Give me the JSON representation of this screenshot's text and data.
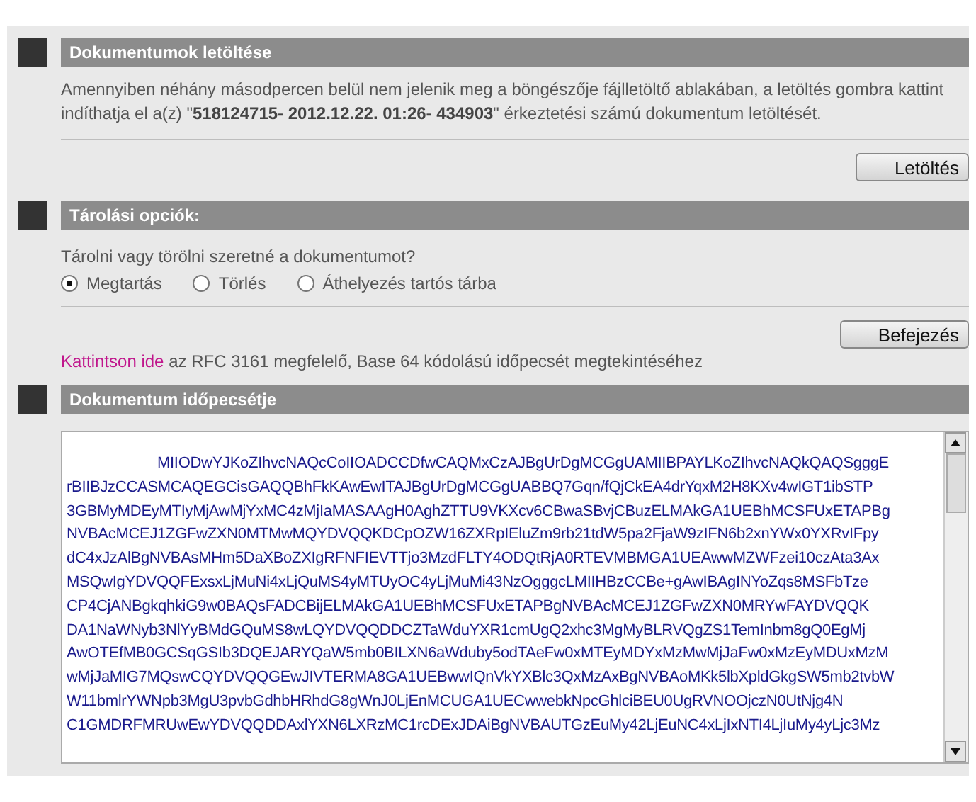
{
  "sections": [
    {
      "kind": "download",
      "title": "Dokumentumok letöltése",
      "text": [
        "Amennyiben néhány másodpercen belül nem jelenik meg a böngészője fájlletöltő ablakában, a letöltés gombra kattint",
        "indíthatja el a(z) \"**518124715- 2012.12.22. 01:26- 434903**\" érkeztetési számú dokumentum letöltését."
      ],
      "button": "Letöltés"
    },
    {
      "kind": "storage",
      "title": "Tárolási opciók:",
      "question": "Tárolni vagy törölni szeretné a dokumentumot?",
      "options": [
        {
          "label": "Megtartás",
          "selected": true
        },
        {
          "label": "Törlés",
          "selected": false
        },
        {
          "label": "Áthelyezés tartós tárba",
          "selected": false
        }
      ],
      "button": "Befejezés",
      "link": "Kattintson ide",
      "link_text": "az RFC 3161 megfelelő, Base 64 kódolású időpecsét megtekintéséhez"
    },
    {
      "kind": "timestamp",
      "title": "Dokumentum időpecsétje",
      "lines": [
        "MIIODwYJKoZIhvcNAQcCoIIOADCCDfwCAQMxCzAJBgUrDgMCGgUAMIIBPAYLKoZIhvcNAQkQAQSgggE",
        "rBIIBJzCCASMCAQEGCisGAQQBhFkKAwEwITAJBgUrDgMCGgUABBQ7Gqn/fQjCkEA4drYqxM2H8KXv4wIGT1ibSTP",
        "3GBMyMDEyMTIyMjAwMjYxMC4zMjIaMASAAgH0AghZTTU9VKXcv6CBwaSBvjCBuzELMAkGA1UEBhMCSFUxETAPBg",
        "NVBAcMCEJ1ZGFwZXN0MTMwMQYDVQQKDCpOZW16ZXRpIEluZm9rb21tdW5pa2FjaW9zIFN6b2xnYWx0YXRvIFpy",
        "dC4xJzAlBgNVBAsMHm5DaXBoZXIgRFNFIEVTTjo3MzdFLTY4ODQtRjA0RTEVMBMGA1UEAwwMZWFzei10czAta3Ax",
        "MSQwIgYDVQQFExsxLjMuNi4xLjQuMS4yMTUyOC4yLjMuMi43NzOgggcLMIIHBzCCBe+gAwIBAgINYoZqs8MSFbTze",
        "CP4CjANBgkqhkiG9w0BAQsFADCBijELMAkGA1UEBhMCSFUxETAPBgNVBAcMCEJ1ZGFwZXN0MRYwFAYDVQQK",
        "DA1NaWNyb3NlYyBMdGQuMS8wLQYDVQQDDCZTaWduYXR1cmUgQ2xhc3MgMyBLRVQgZS1TemInbm8gQ0EgMj",
        "AwOTEfMB0GCSqGSIb3DQEJARYQaW5mb0BILXN6aWduby5odTAeFw0xMTEyMDYxMzMwMjJaFw0xMzEyMDUxMzM",
        "wMjJaMIG7MQswCQYDVQQGEwJIVTERMA8GA1UEBwwIQnVkYXBlc3QxMzAxBgNVBAoMKk5lbXpldGkgSW5mb2tvbW",
        "W11bmlrYWNpb3MgU3pvbGdhbHRhdG8gWnJ0LjEnMCUGA1UECwwebkNpcGhlciBEU0UgRVNOOjczN0UtNjg4N",
        "C1GMDRFMRUwEwYDVQQDDAxlYXN6LXRzMC1rcDExJDAiBgNVBAUTGzEuMy42LjEuNC4xLjIxNTI4LjIuMy4yLjc3Mz"
      ]
    }
  ]
}
